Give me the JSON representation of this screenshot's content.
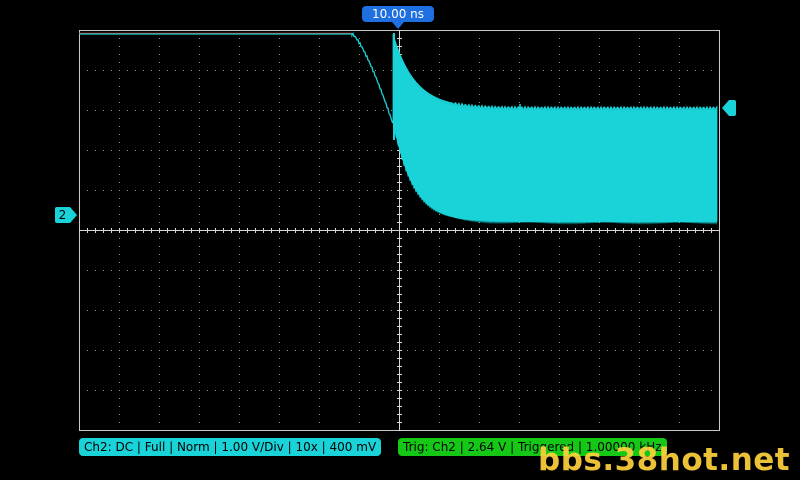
{
  "timebase": {
    "label": "10.00 ns"
  },
  "channel_marker": {
    "label": "2"
  },
  "status_channel": {
    "text": "Ch2: DC | Full | Norm | 1.00 V/Div | 10x | 400 mV"
  },
  "status_trigger": {
    "text": "Trig: Ch2 | 2.64 V | Triggered | 1.00000 kHz"
  },
  "watermark": {
    "text": "bbs.38hot.net"
  },
  "colors": {
    "background": "#000000",
    "grid": "#ffffff",
    "trace": "#19d3d8",
    "reference_line": "#e0302a",
    "timebase_badge": "#1e6fe0",
    "trigger_status": "#16c816",
    "watermark": "#ffd23c"
  }
}
